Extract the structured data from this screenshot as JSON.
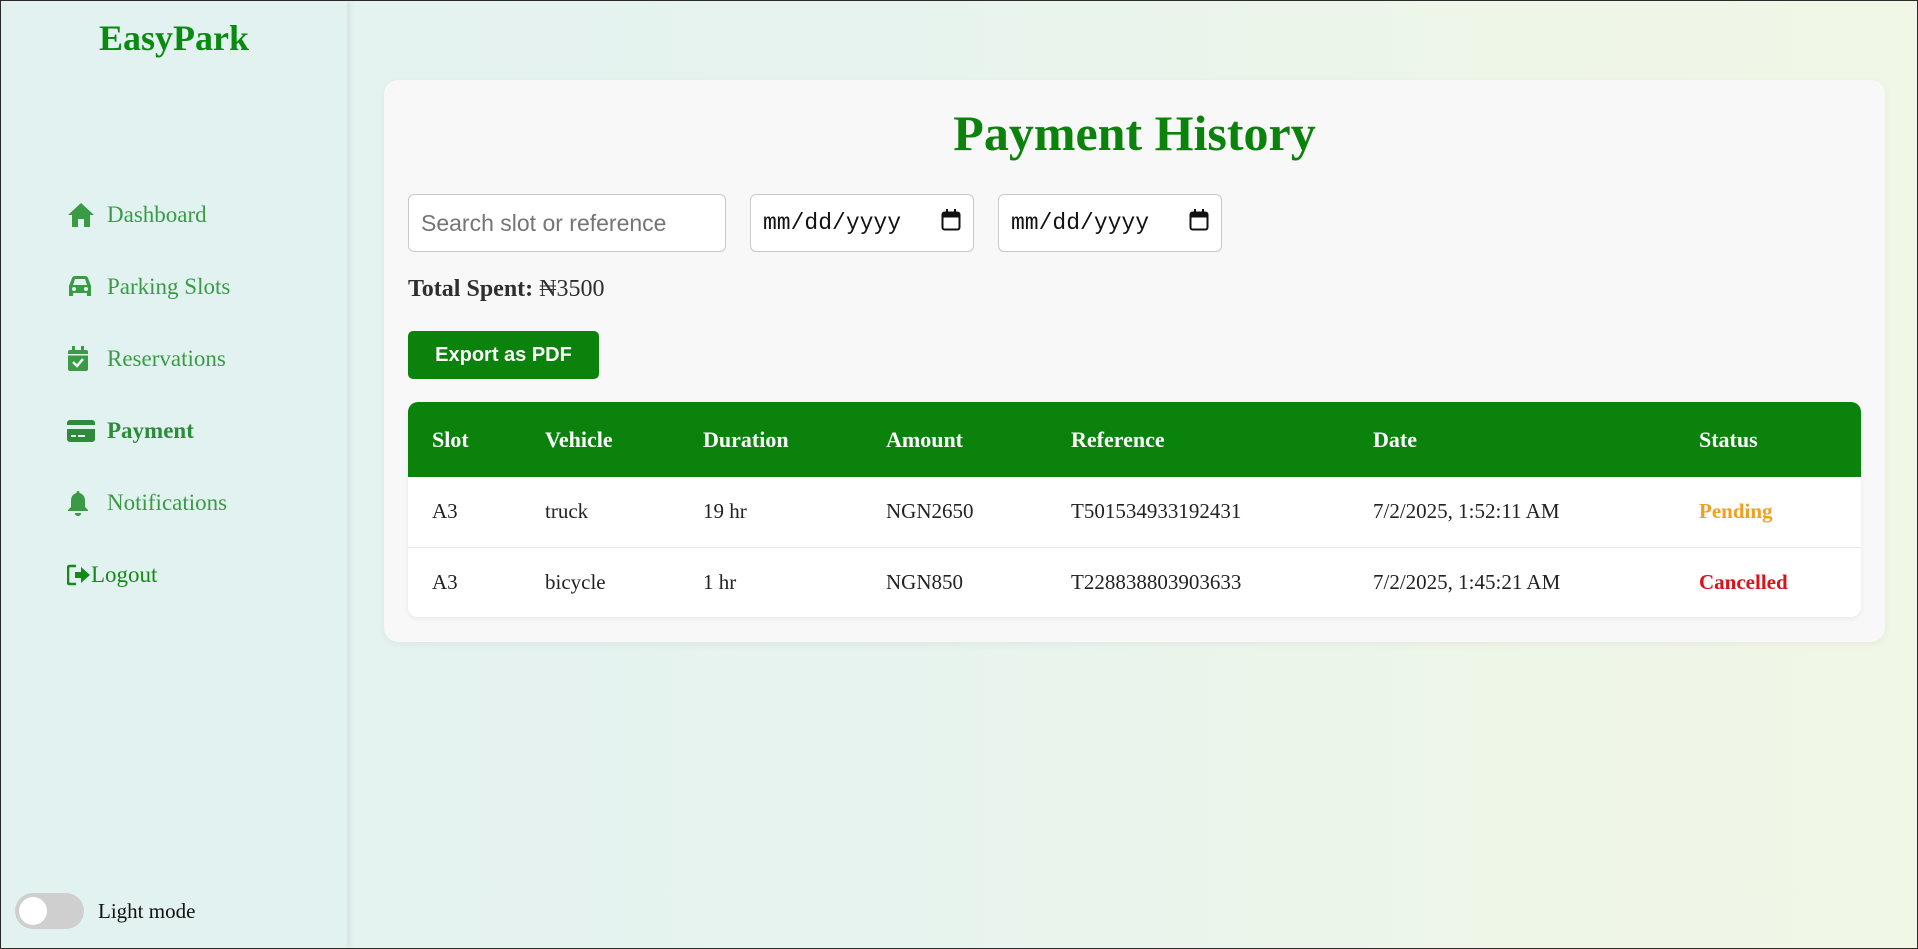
{
  "app": {
    "brand": "EasyPark"
  },
  "sidebar": {
    "items": [
      {
        "label": "Dashboard",
        "icon": "home-icon"
      },
      {
        "label": "Parking Slots",
        "icon": "car-icon"
      },
      {
        "label": "Reservations",
        "icon": "calendar-check-icon"
      },
      {
        "label": "Payment",
        "icon": "credit-card-icon",
        "active": true
      },
      {
        "label": "Notifications",
        "icon": "bell-icon"
      },
      {
        "label": "Logout",
        "icon": "logout-icon"
      }
    ],
    "theme_label": "Light mode"
  },
  "main": {
    "title": "Payment History",
    "search": {
      "placeholder": "Search slot or reference",
      "value": ""
    },
    "date_from": {
      "value": "mm/dd/yyyy"
    },
    "date_to": {
      "value": "mm/dd/yyyy"
    },
    "total_label": "Total Spent:",
    "total_value": "₦3500",
    "export_label": "Export as PDF",
    "table": {
      "headers": [
        "Slot",
        "Vehicle",
        "Duration",
        "Amount",
        "Reference",
        "Date",
        "Status"
      ],
      "rows": [
        [
          "A3",
          "truck",
          "19 hr",
          "NGN2650",
          "T501534933192431",
          "7/2/2025, 1:52:11 AM",
          "Pending"
        ],
        [
          "A3",
          "bicycle",
          "1 hr",
          "NGN850",
          "T228838803903633",
          "7/2/2025, 1:45:21 AM",
          "Cancelled"
        ]
      ]
    }
  },
  "colors": {
    "brand_green": "#0b820b",
    "status_pending": "#f0a020",
    "status_cancelled": "#d8141b"
  }
}
